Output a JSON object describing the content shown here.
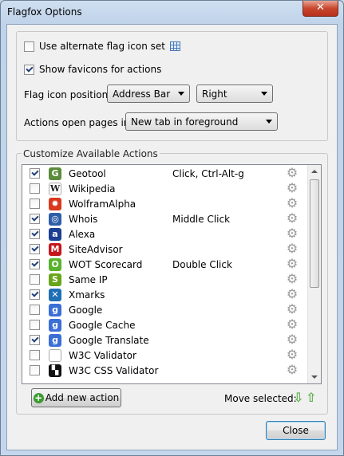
{
  "window": {
    "title": "Flagfox Options",
    "close_glyph": "✕"
  },
  "options": {
    "alt_flag_icon": {
      "label": "Use alternate flag icon set",
      "checked": false
    },
    "show_favicons": {
      "label": "Show favicons for actions",
      "checked": true
    },
    "flag_position_label": "Flag icon position:",
    "flag_position_value": "Address Bar",
    "flag_side_value": "Right",
    "open_pages_label": "Actions open pages in:",
    "open_pages_value": "New tab in foreground"
  },
  "actions": {
    "group_title": "Customize Available Actions",
    "items": [
      {
        "name": "Geotool",
        "checked": true,
        "shortcut": "Click, Ctrl-Alt-g",
        "icon": "geotool-icon",
        "color": "#5b8c3a",
        "glyph": "G"
      },
      {
        "name": "Wikipedia",
        "checked": false,
        "shortcut": "",
        "icon": "wikipedia-icon",
        "color": "#ffffff",
        "glyph": "W"
      },
      {
        "name": "WolframAlpha",
        "checked": false,
        "shortcut": "",
        "icon": "wolframalpha-icon",
        "color": "#d9381e",
        "glyph": "✹"
      },
      {
        "name": "Whois",
        "checked": true,
        "shortcut": "Middle Click",
        "icon": "whois-icon",
        "color": "#2f5ea8",
        "glyph": "◎"
      },
      {
        "name": "Alexa",
        "checked": true,
        "shortcut": "",
        "icon": "alexa-icon",
        "color": "#1c3f94",
        "glyph": "a"
      },
      {
        "name": "SiteAdvisor",
        "checked": true,
        "shortcut": "",
        "icon": "siteadvisor-icon",
        "color": "#c4161c",
        "glyph": "M"
      },
      {
        "name": "WOT Scorecard",
        "checked": true,
        "shortcut": "Double Click",
        "icon": "wot-icon",
        "color": "#59b22c",
        "glyph": "O"
      },
      {
        "name": "Same IP",
        "checked": false,
        "shortcut": "",
        "icon": "sameip-icon",
        "color": "#69a51b",
        "glyph": "S"
      },
      {
        "name": "Xmarks",
        "checked": true,
        "shortcut": "",
        "icon": "xmarks-icon",
        "color": "#1f6fb5",
        "glyph": "✕"
      },
      {
        "name": "Google",
        "checked": false,
        "shortcut": "",
        "icon": "google-icon",
        "color": "#3b6fd6",
        "glyph": "g"
      },
      {
        "name": "Google Cache",
        "checked": false,
        "shortcut": "",
        "icon": "google-cache-icon",
        "color": "#3b6fd6",
        "glyph": "g"
      },
      {
        "name": "Google Translate",
        "checked": true,
        "shortcut": "",
        "icon": "google-translate-icon",
        "color": "#3b6fd6",
        "glyph": "g"
      },
      {
        "name": "W3C Validator",
        "checked": false,
        "shortcut": "",
        "icon": "w3c-validator-icon",
        "color": "#ffffff",
        "glyph": ""
      },
      {
        "name": "W3C CSS Validator",
        "checked": false,
        "shortcut": "",
        "icon": "w3c-css-validator-icon",
        "color": "#111111",
        "glyph": "▚"
      }
    ]
  },
  "footer": {
    "add_label": "Add new action",
    "move_label": "Move selected:",
    "close_label": "Close"
  }
}
